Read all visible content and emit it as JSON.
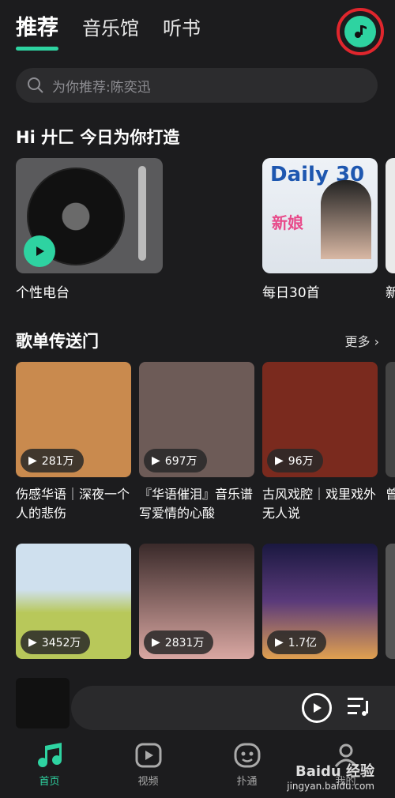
{
  "top_tabs": [
    "推荐",
    "音乐馆",
    "听书"
  ],
  "search": {
    "placeholder": "为你推荐:陈奕迅"
  },
  "greeting": "Hi 廾匚  今日为你打造",
  "features": [
    {
      "label": "个性电台"
    },
    {
      "label": "每日30首",
      "logo": "Daily 30",
      "sub": "新娘"
    },
    {
      "label": "新"
    }
  ],
  "section": {
    "title": "歌单传送门",
    "more": "更多"
  },
  "playlists": [
    {
      "count": "281万",
      "title": "伤感华语｜深夜一个人的悲伤",
      "color": "#c98a4e"
    },
    {
      "count": "697万",
      "title": "『华语催泪』音乐谱写爱情的心酸",
      "color": "#6d5b57"
    },
    {
      "count": "96万",
      "title": "古风戏腔｜戏里戏外无人说",
      "color": "#7a2a1e"
    },
    {
      "count": "",
      "title": "曾尘",
      "color": "#444"
    },
    {
      "count": "3452万",
      "title": "",
      "color": "#b8c85a"
    },
    {
      "count": "2831万",
      "title": "",
      "color": "#d9a7a2"
    },
    {
      "count": "1.7亿",
      "title": "",
      "color": "#2b2a5a"
    },
    {
      "count": "",
      "title": "",
      "color": "#555"
    }
  ],
  "bottom_nav": [
    {
      "label": "首页",
      "icon": "music-note-icon"
    },
    {
      "label": "视频",
      "icon": "video-play-icon"
    },
    {
      "label": "扑通",
      "icon": "face-icon"
    },
    {
      "label": "我的",
      "icon": "person-icon"
    }
  ],
  "watermark": {
    "brand": "Baidu 经验",
    "url": "jingyan.baidu.com"
  },
  "colors": {
    "accent": "#2ed3a1",
    "highlight_ring": "#e0262d",
    "bg": "#1c1c1e"
  }
}
